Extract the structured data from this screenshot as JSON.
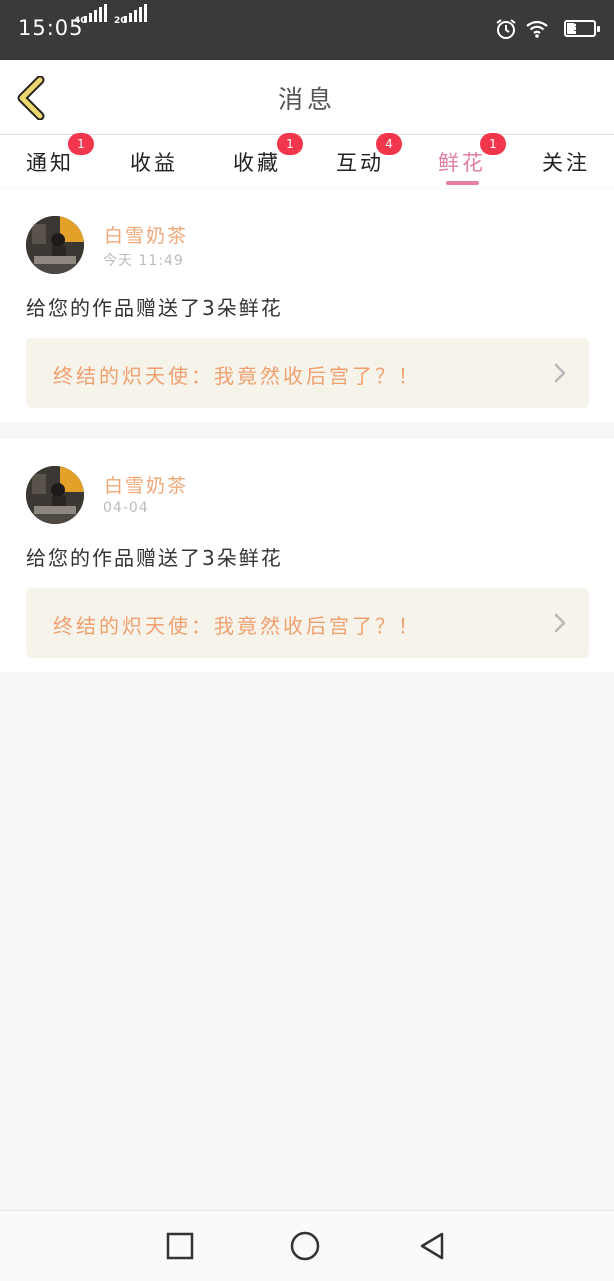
{
  "status_bar": {
    "time": "15:05",
    "net1": "4G",
    "net2": "2G",
    "battery": "36",
    "battery_level": 0.36
  },
  "header": {
    "title": "消息",
    "back_icon": "chevron-left-icon"
  },
  "tabs": [
    {
      "label": "通知",
      "badge": "1"
    },
    {
      "label": "收益",
      "badge": ""
    },
    {
      "label": "收藏",
      "badge": "1"
    },
    {
      "label": "互动",
      "badge": "4"
    },
    {
      "label": "鲜花",
      "badge": "1",
      "active": true
    },
    {
      "label": "关注",
      "badge": ""
    }
  ],
  "messages": [
    {
      "username": "白雪奶茶",
      "time": "今天 11:49",
      "text": "给您的作品赠送了3朵鲜花",
      "work_title": "终结的炽天使：我竟然收后宫了？！"
    },
    {
      "username": "白雪奶茶",
      "time": "04-04",
      "text": "给您的作品赠送了3朵鲜花",
      "work_title": "终结的炽天使：我竟然收后宫了？！"
    }
  ],
  "nav": {
    "recent_icon": "square-icon",
    "home_icon": "circle-icon",
    "back_icon": "triangle-back-icon"
  },
  "colors": {
    "accent_tab": "#e07fa0",
    "badge": "#f2364c",
    "username": "#f0a878",
    "work_link_bg": "#f6f4ea",
    "back_arrow": "#e8d36a"
  }
}
